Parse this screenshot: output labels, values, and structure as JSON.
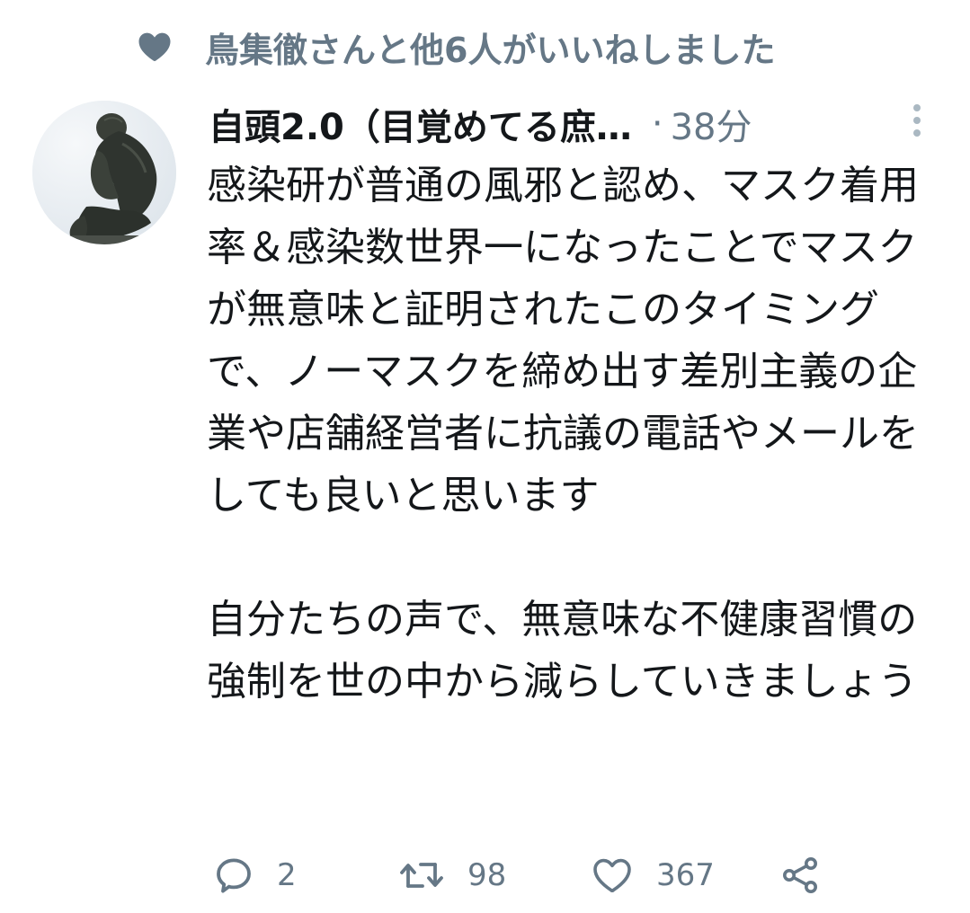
{
  "social_context": {
    "icon": "heart-icon",
    "text": "鳥集徹さんと他6人がいいねしました"
  },
  "tweet": {
    "avatar_icon": "thinker-statue-avatar",
    "display_name": "自頭2.0（目覚めてる庶…",
    "separator": "·",
    "time": "38分",
    "more_icon": "more-vertical-icon",
    "paragraphs": [
      "感染研が普通の風邪と認め、マスク着用率＆感染数世界一になったことでマスクが無意味と証明されたこのタイミングで、ノーマスクを締め出す差別主義の企業や店舗経営者に抗議の電話やメールをしても良いと思います",
      "",
      "自分たちの声で、無意味な不健康習慣の強制を世の中から減らしていきましょう"
    ]
  },
  "actions": {
    "reply": {
      "icon": "reply-icon",
      "count": "2"
    },
    "retweet": {
      "icon": "retweet-icon",
      "count": "98"
    },
    "like": {
      "icon": "like-icon",
      "count": "367"
    },
    "share": {
      "icon": "share-icon"
    }
  },
  "colors": {
    "text_primary": "#14171a",
    "text_secondary": "#657786",
    "icon_muted": "#657786"
  }
}
